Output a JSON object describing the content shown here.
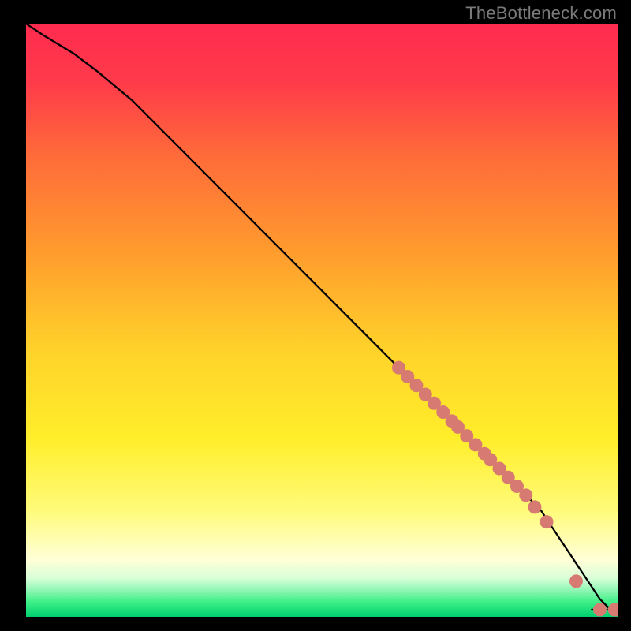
{
  "watermark": "TheBottleneck.com",
  "colors": {
    "background": "#000000",
    "gradient_top": "#ff2b4f",
    "gradient_mid_upper": "#ff8a2a",
    "gradient_mid": "#ffe92a",
    "gradient_pale": "#ffffcc",
    "gradient_green_band_top": "#f8ffd8",
    "gradient_green_band": "#3df086",
    "gradient_green_deep": "#00d070",
    "curve": "#000000",
    "marker_fill": "#d67a72",
    "marker_stroke": "#7a3b36"
  },
  "chart_data": {
    "type": "line",
    "title": "",
    "xlabel": "",
    "ylabel": "",
    "xlim": [
      0,
      100
    ],
    "ylim": [
      0,
      100
    ],
    "series": [
      {
        "name": "bottleneck-curve",
        "x": [
          0,
          3,
          8,
          12,
          18,
          25,
          32,
          40,
          48,
          56,
          63,
          69,
          74,
          78,
          81,
          84,
          87,
          89,
          91,
          93,
          95,
          97,
          99,
          100
        ],
        "y": [
          100,
          98,
          95,
          92,
          87,
          80,
          73,
          65,
          57,
          49,
          42,
          36,
          31,
          27,
          24,
          21,
          18,
          15,
          12,
          9,
          6,
          3,
          1,
          1
        ]
      }
    ],
    "markers": {
      "name": "highlighted-points",
      "x": [
        63,
        64.5,
        66,
        67.5,
        69,
        70.5,
        72,
        73,
        74.5,
        76,
        77.5,
        78.5,
        80,
        81.5,
        83,
        84.5,
        86,
        88,
        93,
        97,
        99.5
      ],
      "y": [
        42,
        40.5,
        39,
        37.5,
        36,
        34.5,
        33,
        32,
        30.5,
        29,
        27.5,
        26.5,
        25,
        23.5,
        22,
        20.5,
        18.5,
        16,
        6,
        1.2,
        1.2
      ]
    }
  }
}
